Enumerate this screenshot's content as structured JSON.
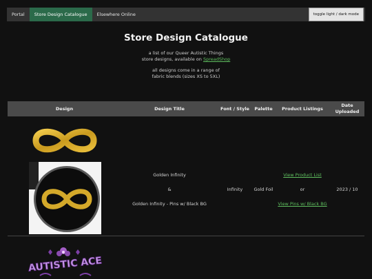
{
  "nav": {
    "items": [
      {
        "label": "Portal",
        "active": false
      },
      {
        "label": "Store Design Catalogue",
        "active": true
      },
      {
        "label": "Elsewhere Online",
        "active": false
      }
    ],
    "toggle_label": "toggle light / dark mode"
  },
  "page": {
    "title": "Store Design Catalogue",
    "intro_line1": "a list of our Queer Autistic Things",
    "intro_line2_prefix": "store designs, available on ",
    "intro_link": "SpreadShop",
    "intro_line3": "all designs come in a range of",
    "intro_line4": "fabric blends (sizes XS to 5XL)"
  },
  "table": {
    "headers": [
      "Design",
      "Design Title",
      "Font / Style",
      "Palette",
      "Product Listings",
      "Date Uploaded"
    ],
    "row1": {
      "title_top": "Golden Infinity",
      "title_mid": "&",
      "title_bottom": "Golden Infinity - Pins w/ Black BG",
      "font": "Infinity",
      "palette": "Gold Foil",
      "listing_top": "View Product List",
      "listing_mid": "or",
      "listing_bottom": "View Pins w/ Black BG",
      "date": "2023 / 10"
    },
    "row2": {
      "image_text": "AUTISTIC ACE"
    }
  },
  "colors": {
    "background": "#111111",
    "nav_active": "#2b6a4a",
    "link": "#5fbf5f",
    "gold": "#d4a92a",
    "header_bg": "#4a4a4a"
  }
}
